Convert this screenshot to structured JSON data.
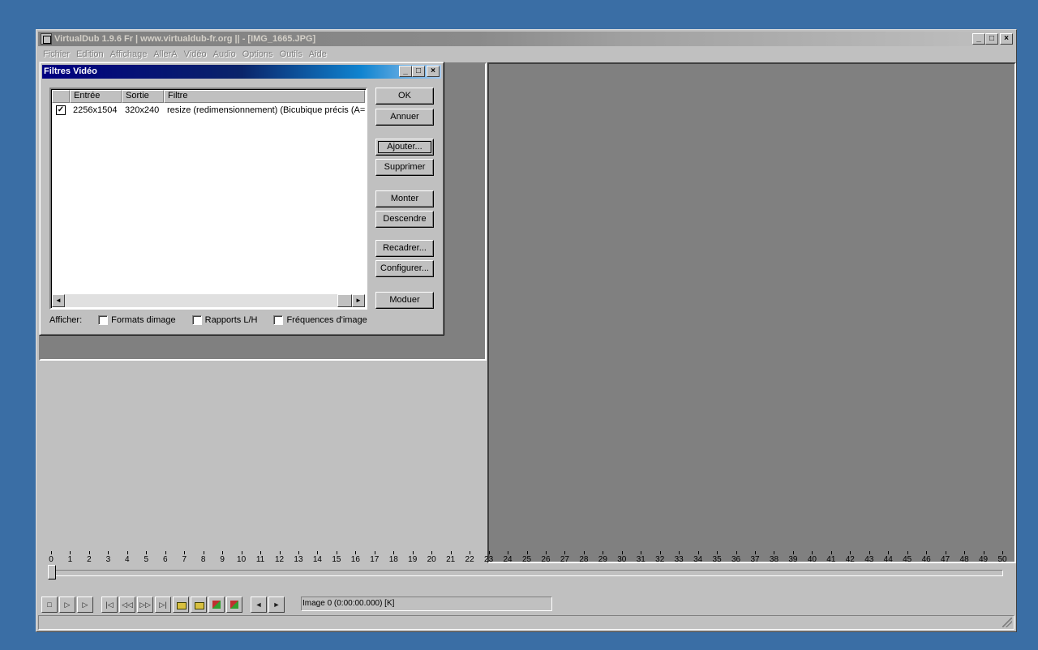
{
  "window": {
    "title": "VirtualDub 1.9.6 Fr | www.virtualdub-fr.org || - [IMG_1665.JPG]",
    "controls": {
      "minimize": "_",
      "maximize": "□",
      "close": "×"
    }
  },
  "menu": [
    "Fichier",
    "Edition",
    "Affichage",
    "AllerA",
    "Vidéo",
    "Audio",
    "Options",
    "Outils",
    "Aide"
  ],
  "dialog": {
    "title": "Filtres Vidéo",
    "columns": [
      "",
      "Entrée",
      "Sortie",
      "Filtre"
    ],
    "rows": [
      {
        "checked": "✓",
        "input": "2256x1504",
        "output": "320x240",
        "filter": "resize (redimensionnement) (Bicubique précis (A=-0."
      }
    ],
    "scroll_left": "◄",
    "scroll_right": "►",
    "buttons": {
      "ok": "OK",
      "cancel": "Annuer",
      "add": "Ajouter...",
      "delete": "Supprimer",
      "up": "Monter",
      "down": "Descendre",
      "crop": "Recadrer...",
      "configure": "Configurer...",
      "blend": "Moduer"
    },
    "show_label": "Afficher:",
    "show_options": [
      "Formats dimage",
      "Rapports L/H",
      "Fréquences d'image"
    ]
  },
  "timeline": {
    "ticks": [
      "0",
      "1",
      "2",
      "3",
      "4",
      "5",
      "6",
      "7",
      "8",
      "9",
      "10",
      "11",
      "12",
      "13",
      "14",
      "15",
      "16",
      "17",
      "18",
      "19",
      "20",
      "21",
      "22",
      "23",
      "24",
      "25",
      "26",
      "27",
      "28",
      "29",
      "30",
      "31",
      "32",
      "33",
      "34",
      "35",
      "36",
      "37",
      "38",
      "39",
      "40",
      "41",
      "42",
      "43",
      "44",
      "45",
      "46",
      "47",
      "48",
      "49",
      "50"
    ],
    "position": 0
  },
  "toolbar": {
    "buttons": [
      "stop-icon",
      "play-input-icon",
      "play-output-icon",
      "start-icon",
      "prev-key-icon",
      "next-key-icon",
      "end-icon",
      "scene-back-icon",
      "scene-fwd-icon",
      "mark-in-icon",
      "mark-out-icon",
      "prev-frame-icon",
      "next-frame-icon"
    ],
    "labels": {
      "stop": "□",
      "play_in": "▷",
      "play_out": "▷",
      "start": "|◁",
      "prev_key": "◁◁",
      "next_key": "▷▷",
      "end": "▷|",
      "mark_prev": "◄",
      "mark_next": "►"
    },
    "status": "Image 0 (0:00:00.000) [K]"
  }
}
